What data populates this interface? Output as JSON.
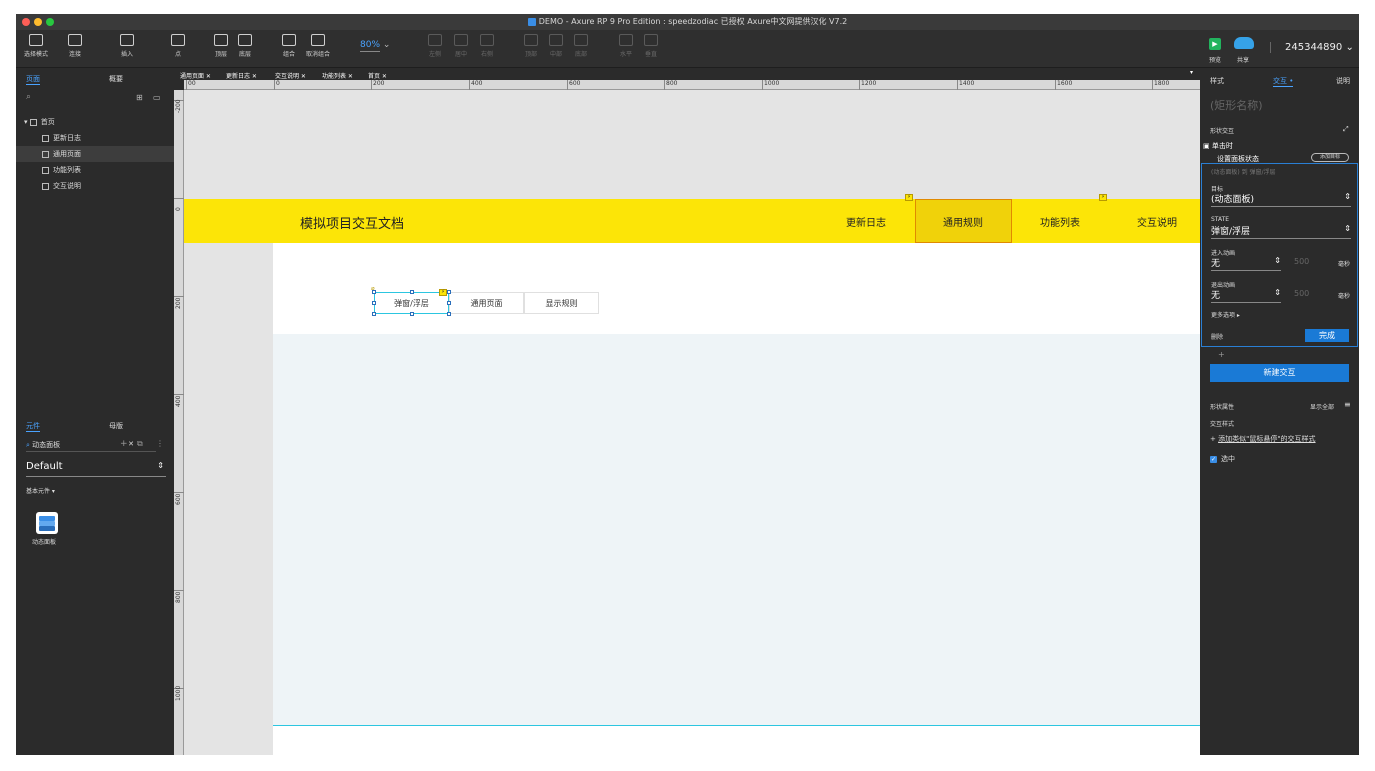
{
  "window": {
    "title_badge": "X",
    "title": "DEMO - Axure RP 9 Pro Edition : speedzodiac 已授权   Axure中文网提供汉化 V7.2"
  },
  "toolbar": {
    "select_mode": "选择模式",
    "connect": "连接",
    "insert": "插入",
    "point": "点",
    "top": "顶层",
    "bottom": "底层",
    "group": "组合",
    "ungroup": "取消组合",
    "zoom": "80%",
    "align_left": "左侧",
    "align_center": "居中",
    "align_right": "右侧",
    "align_top": "顶部",
    "align_middle": "中部",
    "align_bottom": "底部",
    "horizontal": "水平",
    "vertical": "垂直",
    "preview": "预览",
    "share": "共享",
    "account": "245344890"
  },
  "left_panel": {
    "tabs": [
      "页面",
      "概要"
    ],
    "pages": [
      {
        "label": "首页",
        "level": 0,
        "selected": false
      },
      {
        "label": "更新日志",
        "level": 1,
        "selected": false
      },
      {
        "label": "通用页面",
        "level": 1,
        "selected": true
      },
      {
        "label": "功能列表",
        "level": 1,
        "selected": false
      },
      {
        "label": "交互说明",
        "level": 1,
        "selected": false
      }
    ],
    "lib_tabs": [
      "元件",
      "母版"
    ],
    "lib_search": "动态面板",
    "library": "Default",
    "section": "基本元件",
    "widget_label": "动态面板"
  },
  "doc_tabs": [
    "通用页面",
    "更新日志",
    "交互说明",
    "功能列表",
    "首页"
  ],
  "rulers": {
    "h": [
      "00",
      "0",
      "200",
      "400",
      "600",
      "800",
      "1000",
      "1200",
      "1400",
      "1600",
      "1800"
    ],
    "v": [
      "-200",
      "0",
      "200",
      "400",
      "600",
      "800",
      "1000"
    ]
  },
  "canvas": {
    "site_title": "模拟项目交互文档",
    "nav": [
      "更新日志",
      "通用规则",
      "功能列表",
      "交互说明"
    ],
    "active_nav": "通用规则",
    "segments": [
      "弹窗/浮层",
      "通用页面",
      "显示规则"
    ]
  },
  "right_panel": {
    "tabs": [
      "样式",
      "交互",
      "说明"
    ],
    "shape_name": "(矩形名称)",
    "shape_interactions": "形状交互",
    "event": "单击时",
    "action": "设置面板状态",
    "add_target": "添加目标",
    "summary": "(动态面板) 到 弹窗/浮层",
    "target_label": "目标",
    "target_value": "(动态面板)",
    "state_label": "STATE",
    "state_value": "弹窗/浮层",
    "enter_anim_label": "进入动画",
    "enter_anim_value": "无",
    "enter_ms": "500",
    "exit_anim_label": "退出动画",
    "exit_anim_value": "无",
    "exit_ms": "500",
    "ms_unit": "毫秒",
    "more_options": "更多选项",
    "delete": "删除",
    "done": "完成",
    "plus": "+",
    "new_interaction": "新建交互",
    "shape_props": "形状属性",
    "show_all": "显示全部",
    "interaction_styles": "交互样式",
    "add_hover_style": "添加类似\"鼠标悬停\"的交互样式",
    "selected_label": "选中"
  },
  "colors": {
    "header_yellow": "#fce507",
    "accent_blue": "#1a7ad6"
  }
}
